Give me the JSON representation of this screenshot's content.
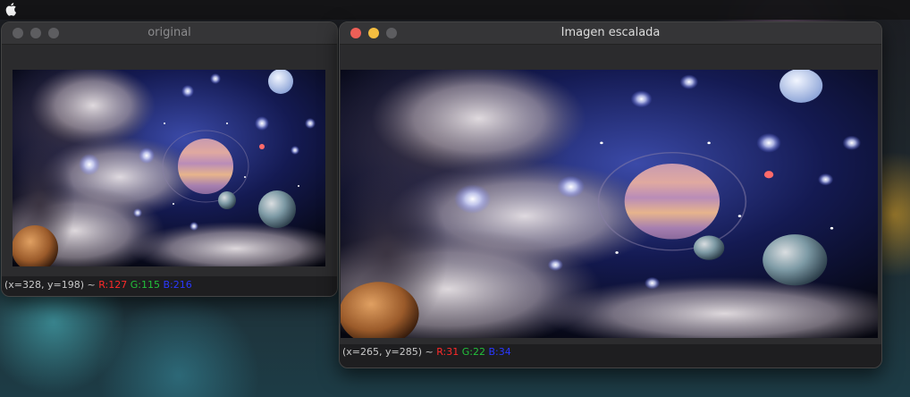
{
  "windows": {
    "original": {
      "title": "original",
      "status": {
        "coords": "(x=328, y=198) ~",
        "r": "R:127",
        "g": "G:115",
        "b": "B:216"
      }
    },
    "scaled": {
      "title": "Imagen escalada",
      "status": {
        "coords": "(x=265, y=285) ~",
        "r": "R:31",
        "g": "G:22",
        "b": "B:34"
      }
    }
  },
  "colors": {
    "close": "#ed5f57",
    "minimize": "#f4bd40",
    "inactive_button": "#5d5d60",
    "red_channel": "#ff2a2a",
    "green_channel": "#23c03a",
    "blue_channel": "#2a38ff"
  },
  "icons": {
    "menubar": "apple-icon"
  }
}
